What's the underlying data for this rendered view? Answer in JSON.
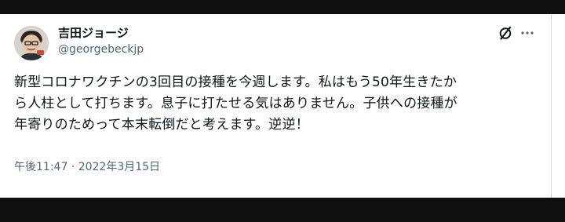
{
  "author": {
    "display_name": "吉田ジョージ",
    "handle": "@georgebeckjp"
  },
  "tweet": {
    "lines": [
      "新型コロナワクチンの3回目の接種を今週します。私はもう50年生きたか",
      "ら人柱として打ちます。息子に打たせる気はありません。子供への接種が",
      "年寄りのためって本末転倒だと考えます。逆逆！"
    ],
    "timestamp": "午後11:47 · 2022年3月15日"
  },
  "icons": {
    "grok": "grok-icon",
    "more": "more-options-icon"
  }
}
